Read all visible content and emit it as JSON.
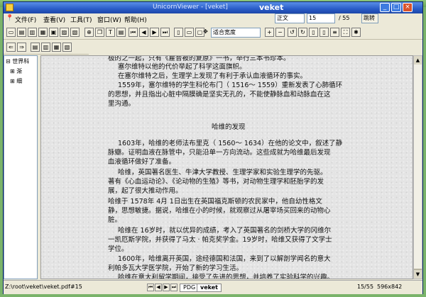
{
  "window": {
    "title": "UnicornViewer - [veket]",
    "watermark": "veket"
  },
  "topcontrols": {
    "format": "正文",
    "page_input": "15",
    "page_total": "/ 55",
    "jump_label": "跳转"
  },
  "menu": [
    "文件(F)",
    "查看(V)",
    "工具(T)",
    "窗口(W)",
    "帮助(H)"
  ],
  "zoom": "适合宽度",
  "sidebar": {
    "items": [
      "世界科",
      "渐",
      "细"
    ]
  },
  "document": {
    "lines": [
      "极的之一起，只有《雇普被的复原》一书，举行三本书珍本。",
      "塞尔维特以他的代价举起了科学这面旗帜。",
      "在塞尔维特之后，生理学上发现了有利于承认血液循环的事实。",
      "1559年，塞尔维特的学生科伦布门（ 1516～ 1559）重新发表了心肺循环",
      "的思想，并且指出心脏中隔膜确是坚实无孔的，不能使静脉血和动脉血在这",
      "里沟通。",
      "1603年，哈维的老师法布里克（ 1560～ 1634）在他的论文中，叙述了静",
      "脉瓣。证明血液在脉管中，只能沿单一方向流动。这些成就为哈维最后发现",
      "血液循环做好了准备。",
      "哈维，英国著名医生、牛津大学教授、生理学家和实验生理学的先驱。",
      "著有《心血运动论》、《论动物的生殖》等书，对动物生理学和胚胎学的发",
      "展，起了很大推动作用。",
      "哈维于 1578年 4月 1日出生在英国福克斯顿的农民家中，他自幼性格文",
      "静，思想敏捷。据说，哈维在小的时候，就观察过从屠宰场买回来的动物心",
      "脏。",
      "哈维在 16岁时，就以优异的成绩，考入了英国著名的剑桥大学的冈维尔",
      "一凯厄斯学院，并获得了马太 · 帕克奖学金。19岁时，哈维又获得了文学士",
      "学位。",
      "1600年，哈维离开英国，途经德国和法国，来到了以解剖学闻名的意大",
      "利帕多瓦大学医学院，开始了新的学习生活。",
      "哈维在意大利留学期间，接受了先进的思想，并培养了实验科学的兴趣。"
    ],
    "heading": "哈维的发现"
  },
  "status": {
    "path": "Z:\\root\\veket\\veket.pdf#15",
    "tab1": "PDG",
    "tab2": "veket",
    "page": "15/55",
    "size": "596x842"
  }
}
